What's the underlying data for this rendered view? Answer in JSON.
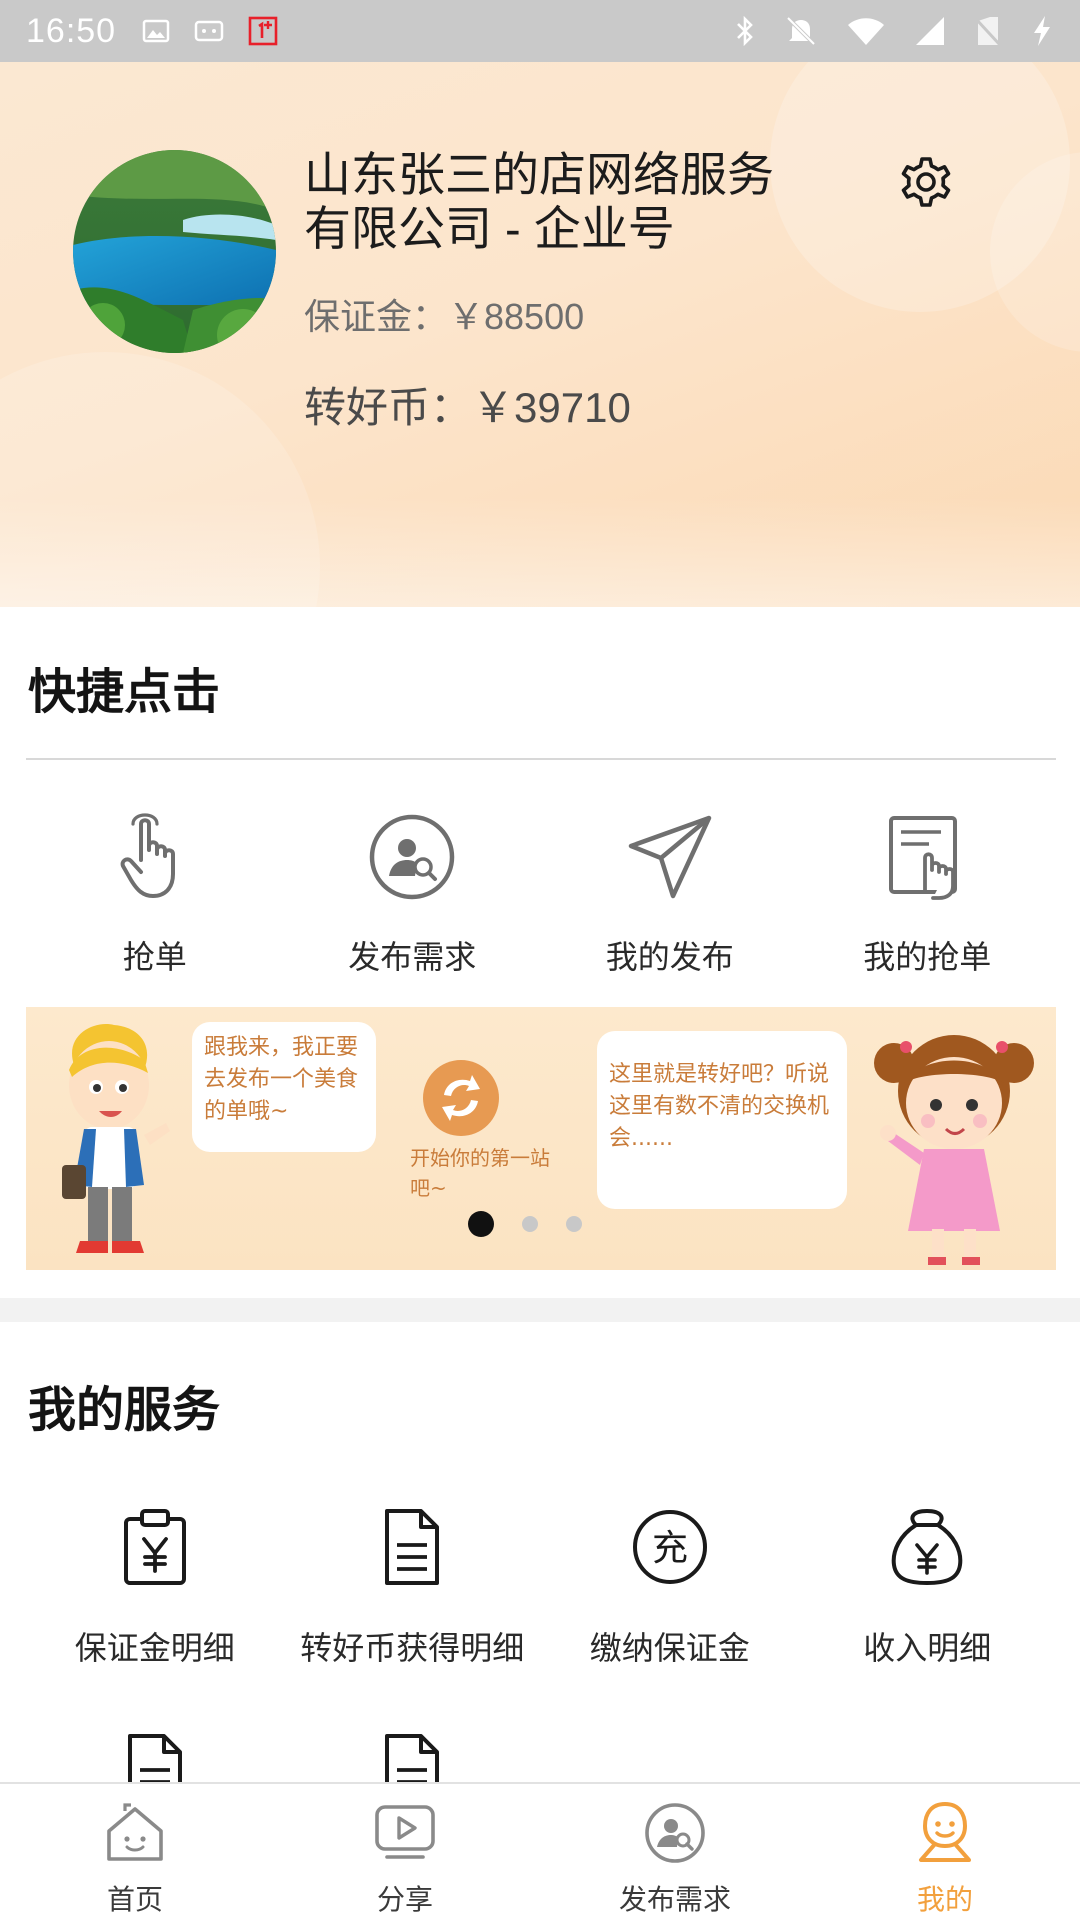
{
  "status_bar": {
    "time": "16:50"
  },
  "profile": {
    "company_name": "山东张三的店网络服务有限公司 - 企业号",
    "deposit_label": "保证金：",
    "deposit_value": "￥88500",
    "coin_label": "转好币：",
    "coin_value": "￥39710"
  },
  "quick_actions": {
    "title": "快捷点击",
    "items": [
      {
        "label": "抢单",
        "icon": "hand-pointer-icon"
      },
      {
        "label": "发布需求",
        "icon": "publish-search-icon"
      },
      {
        "label": "我的发布",
        "icon": "paper-plane-icon"
      },
      {
        "label": "我的抢单",
        "icon": "document-hand-icon"
      }
    ]
  },
  "banner": {
    "bubble_left": "跟我来，我正要去发布一个美食的单哦~",
    "center_text": "开始你的第一站吧~",
    "bubble_right": "这里就是转好吧？听说这里有数不清的交换机会......",
    "slides_total": 3,
    "active_slide": 1
  },
  "services": {
    "title": "我的服务",
    "items": [
      {
        "label": "保证金明细",
        "icon": "deposit-clipboard-icon"
      },
      {
        "label": "转好币获得明细",
        "icon": "document-icon"
      },
      {
        "label": "缴纳保证金",
        "icon": "recharge-icon"
      },
      {
        "label": "收入明细",
        "icon": "money-bag-icon"
      }
    ],
    "more_row_icons": [
      "document-icon",
      "document-icon"
    ]
  },
  "bottom_nav": {
    "items": [
      {
        "label": "首页",
        "icon": "home-icon",
        "active": false
      },
      {
        "label": "分享",
        "icon": "play-icon",
        "active": false
      },
      {
        "label": "发布需求",
        "icon": "publish-search-icon",
        "active": false
      },
      {
        "label": "我的",
        "icon": "user-icon",
        "active": true
      }
    ]
  },
  "colors": {
    "accent": "#f2a03d",
    "status_bar": "#c9c9c9",
    "header_gradient_start": "#fbe8d2",
    "header_gradient_end": "#fbd9b4",
    "banner_text": "#c97c3a"
  }
}
